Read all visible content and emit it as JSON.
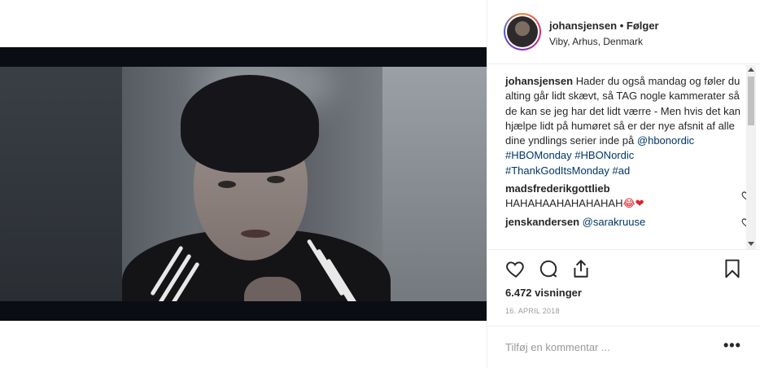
{
  "post": {
    "username": "johansjensen",
    "follow_separator": "•",
    "follow_status": "Følger",
    "location": "Viby, Arhus, Denmark"
  },
  "caption": {
    "username": "johansjensen",
    "text": "Hader du også mandag og føler du alting går lidt skævt, så TAG nogle kammerater så de kan se jeg har det lidt værre - Men hvis det kan hjælpe lidt på humøret så er der nye afsnit af alle dine yndlings serier inde på ",
    "mention": "@hbonordic",
    "hashtags": [
      "#HBOMonday",
      "#HBONordic",
      "#ThankGodItsMonday",
      "#ad"
    ]
  },
  "comments": [
    {
      "username": "madsfrederikgottlieb",
      "text": "HAHAHAAHAHAHAHAH",
      "emoji": "😂❤"
    },
    {
      "username": "jenskandersen",
      "mention": "@sarakruuse"
    }
  ],
  "stats": {
    "views": "6.472 visninger",
    "date": "16. APRIL 2018"
  },
  "add_comment": {
    "placeholder": "Tilføj en kommentar ...",
    "more": "•••"
  },
  "icons": {
    "like": "heart-icon",
    "comment": "comment-icon",
    "share": "share-icon",
    "save": "bookmark-icon",
    "comment_like": "heart-icon"
  },
  "colors": {
    "text": "#262626",
    "link": "#003569",
    "muted": "#999999",
    "border": "#efefef",
    "heart_emoji": "#e0202a"
  }
}
